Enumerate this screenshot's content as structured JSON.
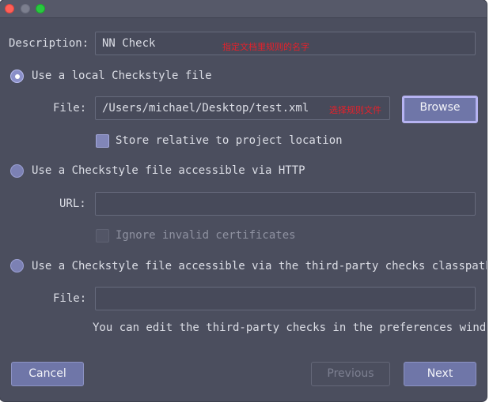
{
  "description": {
    "label": "Description:",
    "value": "NN Check",
    "annotation": "指定文档里规则的名字"
  },
  "options": {
    "local": {
      "label": "Use a local Checkstyle file",
      "selected": true,
      "file_label": "File:",
      "file_value": "/Users/michael/Desktop/test.xml",
      "annotation": "选择规则文件",
      "browse_label": "Browse",
      "store_relative_label": "Store relative to project location"
    },
    "http": {
      "label": "Use a Checkstyle file accessible via HTTP",
      "selected": false,
      "url_label": "URL:",
      "url_value": "",
      "ignore_invalid_label": "Ignore invalid certificates"
    },
    "classpath": {
      "label": "Use a Checkstyle file accessible via the third-party checks classpath",
      "selected": false,
      "file_label": "File:",
      "file_value": "",
      "hint": "You can edit the third-party checks in the preferences window"
    }
  },
  "buttons": {
    "cancel": "Cancel",
    "previous": "Previous",
    "next": "Next"
  },
  "colors": {
    "background": "#4b4e5e",
    "accent": "#6f76a8",
    "annotation": "#e8202a"
  }
}
